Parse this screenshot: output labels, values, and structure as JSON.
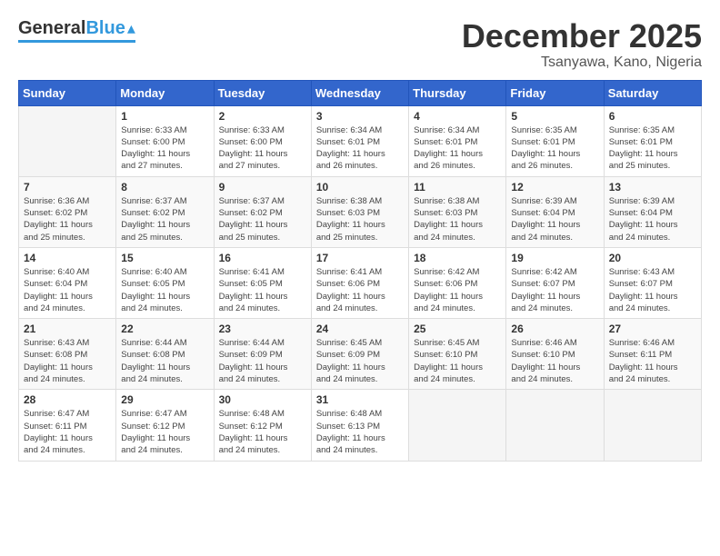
{
  "header": {
    "logo_general": "General",
    "logo_blue": "Blue",
    "month": "December 2025",
    "location": "Tsanyawa, Kano, Nigeria"
  },
  "days_of_week": [
    "Sunday",
    "Monday",
    "Tuesday",
    "Wednesday",
    "Thursday",
    "Friday",
    "Saturday"
  ],
  "weeks": [
    [
      {
        "day": "",
        "info": ""
      },
      {
        "day": "1",
        "info": "Sunrise: 6:33 AM\nSunset: 6:00 PM\nDaylight: 11 hours\nand 27 minutes."
      },
      {
        "day": "2",
        "info": "Sunrise: 6:33 AM\nSunset: 6:00 PM\nDaylight: 11 hours\nand 27 minutes."
      },
      {
        "day": "3",
        "info": "Sunrise: 6:34 AM\nSunset: 6:01 PM\nDaylight: 11 hours\nand 26 minutes."
      },
      {
        "day": "4",
        "info": "Sunrise: 6:34 AM\nSunset: 6:01 PM\nDaylight: 11 hours\nand 26 minutes."
      },
      {
        "day": "5",
        "info": "Sunrise: 6:35 AM\nSunset: 6:01 PM\nDaylight: 11 hours\nand 26 minutes."
      },
      {
        "day": "6",
        "info": "Sunrise: 6:35 AM\nSunset: 6:01 PM\nDaylight: 11 hours\nand 25 minutes."
      }
    ],
    [
      {
        "day": "7",
        "info": "Sunrise: 6:36 AM\nSunset: 6:02 PM\nDaylight: 11 hours\nand 25 minutes."
      },
      {
        "day": "8",
        "info": "Sunrise: 6:37 AM\nSunset: 6:02 PM\nDaylight: 11 hours\nand 25 minutes."
      },
      {
        "day": "9",
        "info": "Sunrise: 6:37 AM\nSunset: 6:02 PM\nDaylight: 11 hours\nand 25 minutes."
      },
      {
        "day": "10",
        "info": "Sunrise: 6:38 AM\nSunset: 6:03 PM\nDaylight: 11 hours\nand 25 minutes."
      },
      {
        "day": "11",
        "info": "Sunrise: 6:38 AM\nSunset: 6:03 PM\nDaylight: 11 hours\nand 24 minutes."
      },
      {
        "day": "12",
        "info": "Sunrise: 6:39 AM\nSunset: 6:04 PM\nDaylight: 11 hours\nand 24 minutes."
      },
      {
        "day": "13",
        "info": "Sunrise: 6:39 AM\nSunset: 6:04 PM\nDaylight: 11 hours\nand 24 minutes."
      }
    ],
    [
      {
        "day": "14",
        "info": "Sunrise: 6:40 AM\nSunset: 6:04 PM\nDaylight: 11 hours\nand 24 minutes."
      },
      {
        "day": "15",
        "info": "Sunrise: 6:40 AM\nSunset: 6:05 PM\nDaylight: 11 hours\nand 24 minutes."
      },
      {
        "day": "16",
        "info": "Sunrise: 6:41 AM\nSunset: 6:05 PM\nDaylight: 11 hours\nand 24 minutes."
      },
      {
        "day": "17",
        "info": "Sunrise: 6:41 AM\nSunset: 6:06 PM\nDaylight: 11 hours\nand 24 minutes."
      },
      {
        "day": "18",
        "info": "Sunrise: 6:42 AM\nSunset: 6:06 PM\nDaylight: 11 hours\nand 24 minutes."
      },
      {
        "day": "19",
        "info": "Sunrise: 6:42 AM\nSunset: 6:07 PM\nDaylight: 11 hours\nand 24 minutes."
      },
      {
        "day": "20",
        "info": "Sunrise: 6:43 AM\nSunset: 6:07 PM\nDaylight: 11 hours\nand 24 minutes."
      }
    ],
    [
      {
        "day": "21",
        "info": "Sunrise: 6:43 AM\nSunset: 6:08 PM\nDaylight: 11 hours\nand 24 minutes."
      },
      {
        "day": "22",
        "info": "Sunrise: 6:44 AM\nSunset: 6:08 PM\nDaylight: 11 hours\nand 24 minutes."
      },
      {
        "day": "23",
        "info": "Sunrise: 6:44 AM\nSunset: 6:09 PM\nDaylight: 11 hours\nand 24 minutes."
      },
      {
        "day": "24",
        "info": "Sunrise: 6:45 AM\nSunset: 6:09 PM\nDaylight: 11 hours\nand 24 minutes."
      },
      {
        "day": "25",
        "info": "Sunrise: 6:45 AM\nSunset: 6:10 PM\nDaylight: 11 hours\nand 24 minutes."
      },
      {
        "day": "26",
        "info": "Sunrise: 6:46 AM\nSunset: 6:10 PM\nDaylight: 11 hours\nand 24 minutes."
      },
      {
        "day": "27",
        "info": "Sunrise: 6:46 AM\nSunset: 6:11 PM\nDaylight: 11 hours\nand 24 minutes."
      }
    ],
    [
      {
        "day": "28",
        "info": "Sunrise: 6:47 AM\nSunset: 6:11 PM\nDaylight: 11 hours\nand 24 minutes."
      },
      {
        "day": "29",
        "info": "Sunrise: 6:47 AM\nSunset: 6:12 PM\nDaylight: 11 hours\nand 24 minutes."
      },
      {
        "day": "30",
        "info": "Sunrise: 6:48 AM\nSunset: 6:12 PM\nDaylight: 11 hours\nand 24 minutes."
      },
      {
        "day": "31",
        "info": "Sunrise: 6:48 AM\nSunset: 6:13 PM\nDaylight: 11 hours\nand 24 minutes."
      },
      {
        "day": "",
        "info": ""
      },
      {
        "day": "",
        "info": ""
      },
      {
        "day": "",
        "info": ""
      }
    ]
  ]
}
